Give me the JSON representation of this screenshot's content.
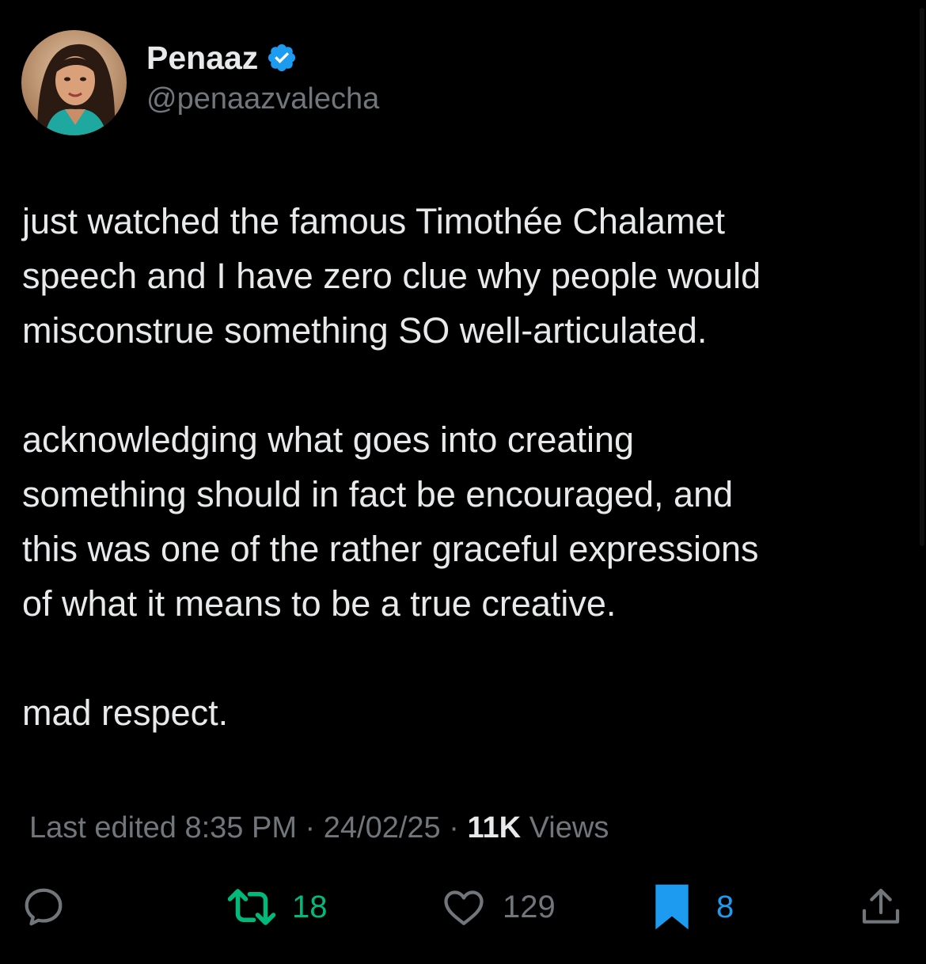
{
  "author": {
    "display_name": "Penaaz",
    "handle": "@penaazvalecha",
    "verified": true,
    "avatar_icon": "profile-photo"
  },
  "tweet": {
    "paragraphs": [
      "just watched the famous Timothée Chalamet\nspeech and I have zero clue why people would\nmisconstrue something SO well-articulated.",
      "acknowledging what goes into creating\nsomething should in fact be encouraged, and\nthis was one of the rather graceful expressions\nof what it means to be a true creative.",
      "mad respect."
    ]
  },
  "meta": {
    "edited_prefix": "Last edited 8:35 PM · 24/02/25 · ",
    "views_count": "11K",
    "views_label": " Views"
  },
  "actions": {
    "reply": {
      "icon": "reply-icon",
      "count": ""
    },
    "retweet": {
      "icon": "retweet-icon",
      "count": "18",
      "color": "#00ba7c"
    },
    "like": {
      "icon": "like-icon",
      "count": "129",
      "color": "#71767b"
    },
    "bookmark": {
      "icon": "bookmark-icon",
      "count": "8",
      "color": "#1d9bf0"
    },
    "share": {
      "icon": "share-icon"
    }
  },
  "colors": {
    "background": "#000000",
    "primary_text": "#e7e9ea",
    "secondary_text": "#71767b",
    "verified_blue": "#1d9bf0",
    "retweet_green": "#00ba7c"
  }
}
